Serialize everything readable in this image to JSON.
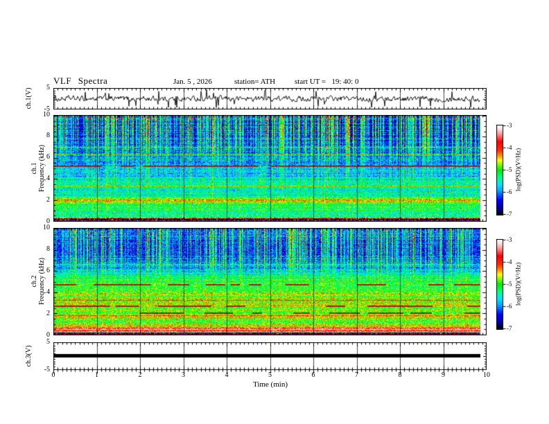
{
  "header": {
    "title": "VLF Spectra",
    "date": "Jan. 5 , 2026",
    "station": "station= ATH",
    "start_ut": "start UT =   19: 40: 0"
  },
  "axes": {
    "time_label": "Time (min)",
    "time_ticks": [
      "0",
      "1",
      "2",
      "3",
      "4",
      "5",
      "6",
      "7",
      "8",
      "9",
      "10"
    ],
    "freq_ticks": [
      "10",
      "8",
      "6",
      "4",
      "2",
      "0"
    ],
    "volt_ticks": [
      "5",
      "-5"
    ],
    "ch1_wave_label": "ch.1(V)",
    "ch3_wave_label": "ch.3(V)",
    "spec1_label_ch": "ch.1",
    "spec2_label_ch": "ch.2",
    "spec_label_freq": "Frequency (kHz)",
    "colorbar_label": "log(PSD)(V²/Hz)",
    "colorbar_ticks": [
      "-3",
      "-4",
      "-5",
      "-6",
      "-7"
    ]
  },
  "colors": {
    "background": "#ffffff",
    "axis": "#000000",
    "gridline": "#444444",
    "trace": "#000000"
  },
  "colormap": [
    [
      0.0,
      "#000004"
    ],
    [
      0.06,
      "#00008c"
    ],
    [
      0.16,
      "#0000ff"
    ],
    [
      0.27,
      "#00aaff"
    ],
    [
      0.34,
      "#00e8ff"
    ],
    [
      0.42,
      "#00ff88"
    ],
    [
      0.5,
      "#00ee00"
    ],
    [
      0.56,
      "#7dff00"
    ],
    [
      0.61,
      "#ffff00"
    ],
    [
      0.66,
      "#ff9900"
    ],
    [
      0.72,
      "#ff3000"
    ],
    [
      0.82,
      "#ff0000"
    ],
    [
      0.9,
      "#ff8d8d"
    ],
    [
      0.96,
      "#ffdcdc"
    ],
    [
      1.0,
      "#ffffff"
    ]
  ],
  "chart_data": [
    {
      "type": "line",
      "name": "ch.1 time series",
      "ylabel": "ch.1(V)",
      "ylim": [
        -5,
        5
      ],
      "x_range_min": [
        0,
        10
      ],
      "xlabel": "Time (min)",
      "signal": {
        "kind": "broadband-noise",
        "rms_volts": 0.9,
        "spike_count": 30,
        "spike_amp_volts": [
          2.6,
          4.8
        ],
        "spike_down_fraction": 0.62,
        "data_end_min": 9.85
      }
    },
    {
      "type": "heatmap",
      "name": "ch.1 spectrogram",
      "ylabel": "ch.1 Frequency (kHz)",
      "ylim": [
        0,
        10
      ],
      "x_range_min": [
        0,
        10
      ],
      "value_range": [
        -7,
        -3
      ],
      "value_units": "log(PSD)(V²/Hz)",
      "value_scale_note": "profile values normalized: 0 = -7, 1 = -3",
      "base_profile": [
        [
          0,
          0.03
        ],
        [
          0.28,
          0.03
        ],
        [
          0.33,
          0.5
        ],
        [
          0.45,
          0.43
        ],
        [
          0.8,
          0.45
        ],
        [
          1.2,
          0.42
        ],
        [
          1.8,
          0.5
        ],
        [
          2.1,
          0.52
        ],
        [
          2.5,
          0.4
        ],
        [
          3.0,
          0.36
        ],
        [
          3.6,
          0.38
        ],
        [
          4.2,
          0.3
        ],
        [
          5.0,
          0.28
        ],
        [
          5.8,
          0.24
        ],
        [
          6.5,
          0.2
        ],
        [
          7.5,
          0.17
        ],
        [
          8.3,
          0.15
        ],
        [
          9.2,
          0.14
        ],
        [
          10,
          0.16
        ]
      ],
      "bands": [
        {
          "f": 0.08,
          "hw": 0.04,
          "color": "maroon",
          "duty": 1
        },
        {
          "f": 0.35,
          "hw": 0.05,
          "amp": 0.18
        },
        {
          "f": 1.95,
          "hw": 0.12,
          "amp": 0.1
        },
        {
          "f": 3.35,
          "hw": 0.05,
          "amp": 0.14
        },
        {
          "f": 4.45,
          "hw": 0.04,
          "amp": 0.1
        },
        {
          "f": 5.2,
          "hw": 0.05,
          "color": "maroon",
          "duty": 0.75
        },
        {
          "f": 6.35,
          "hw": 0.04,
          "amp": 0.2
        },
        {
          "f": 7.0,
          "hw": 0.03,
          "amp": 0.12
        }
      ],
      "streaks": {
        "density": 0.55,
        "scale": 0.5,
        "weight": [
          [
            0,
            0.12
          ],
          [
            2.5,
            0.15
          ],
          [
            4,
            0.3
          ],
          [
            5.5,
            0.38
          ],
          [
            6.5,
            0.55
          ],
          [
            7.5,
            0.75
          ],
          [
            8.2,
            0.95
          ],
          [
            10,
            1.0
          ]
        ]
      },
      "speckles": [
        {
          "fmin": 9.6,
          "fmax": 10,
          "p": 0.07,
          "vmin": 0.7,
          "vmax": 0.95
        },
        {
          "fmin": 0,
          "fmax": 0.28,
          "p": 0.12,
          "vmin": 0.3,
          "vmax": 0.9
        }
      ]
    },
    {
      "type": "heatmap",
      "name": "ch.2 spectrogram",
      "ylabel": "ch.2 Frequency (kHz)",
      "ylim": [
        0,
        10
      ],
      "x_range_min": [
        0,
        10
      ],
      "value_range": [
        -7,
        -3
      ],
      "value_units": "log(PSD)(V²/Hz)",
      "value_scale_note": "profile values normalized: 0 = -7, 1 = -3",
      "base_profile": [
        [
          0,
          0.05
        ],
        [
          0.22,
          0.05
        ],
        [
          0.3,
          0.5
        ],
        [
          0.45,
          0.75
        ],
        [
          0.6,
          0.82
        ],
        [
          0.75,
          0.62
        ],
        [
          0.95,
          0.55
        ],
        [
          1.4,
          0.52
        ],
        [
          1.9,
          0.56
        ],
        [
          2.4,
          0.52
        ],
        [
          2.9,
          0.55
        ],
        [
          3.4,
          0.53
        ],
        [
          4.0,
          0.5
        ],
        [
          4.6,
          0.48
        ],
        [
          5.2,
          0.44
        ],
        [
          5.7,
          0.38
        ],
        [
          6.2,
          0.28
        ],
        [
          6.8,
          0.22
        ],
        [
          7.6,
          0.18
        ],
        [
          8.6,
          0.17
        ],
        [
          9.4,
          0.2
        ],
        [
          10,
          0.22
        ]
      ],
      "bands": [
        {
          "f": 0.07,
          "hw": 0.04,
          "color": "maroon",
          "duty": 1
        },
        {
          "f": 0.35,
          "hw": 0.04,
          "amp": 0.12
        },
        {
          "f": 0.62,
          "hw": 0.08,
          "amp": 0.12
        },
        {
          "f": 1.8,
          "hw": 0.06,
          "amp": 0.16
        },
        {
          "f": 2.05,
          "hw": 0.05,
          "color": "maroon",
          "duty": 0.35
        },
        {
          "f": 2.7,
          "hw": 0.06,
          "color": "maroon",
          "duty": 0.5
        },
        {
          "f": 3.3,
          "hw": 0.05,
          "amp": 0.15
        },
        {
          "f": 3.9,
          "hw": 0.04,
          "amp": 0.12
        },
        {
          "f": 4.7,
          "hw": 0.06,
          "color": "maroon",
          "duty": 0.55
        },
        {
          "f": 6.6,
          "hw": 0.04,
          "amp": 0.15
        },
        {
          "f": 7.3,
          "hw": 0.03,
          "amp": 0.1
        }
      ],
      "streaks": {
        "density": 0.42,
        "scale": 0.45,
        "weight": [
          [
            0,
            0.06
          ],
          [
            4.5,
            0.1
          ],
          [
            5.5,
            0.25
          ],
          [
            6.2,
            0.5
          ],
          [
            7,
            0.8
          ],
          [
            8.5,
            0.95
          ],
          [
            10,
            1.0
          ]
        ]
      },
      "speckles": [
        {
          "fmin": 0,
          "fmax": 0.22,
          "p": 0.1,
          "vmin": 0.3,
          "vmax": 0.85
        }
      ]
    },
    {
      "type": "line",
      "name": "ch.3 time series",
      "ylabel": "ch.3(V)",
      "ylim": [
        -5,
        5
      ],
      "x_range_min": [
        0,
        10
      ],
      "xlabel": "Time (min)",
      "signal": {
        "kind": "flat",
        "value_volts": 0,
        "thickness_volts": 1,
        "data_end_min": 9.85
      }
    }
  ]
}
